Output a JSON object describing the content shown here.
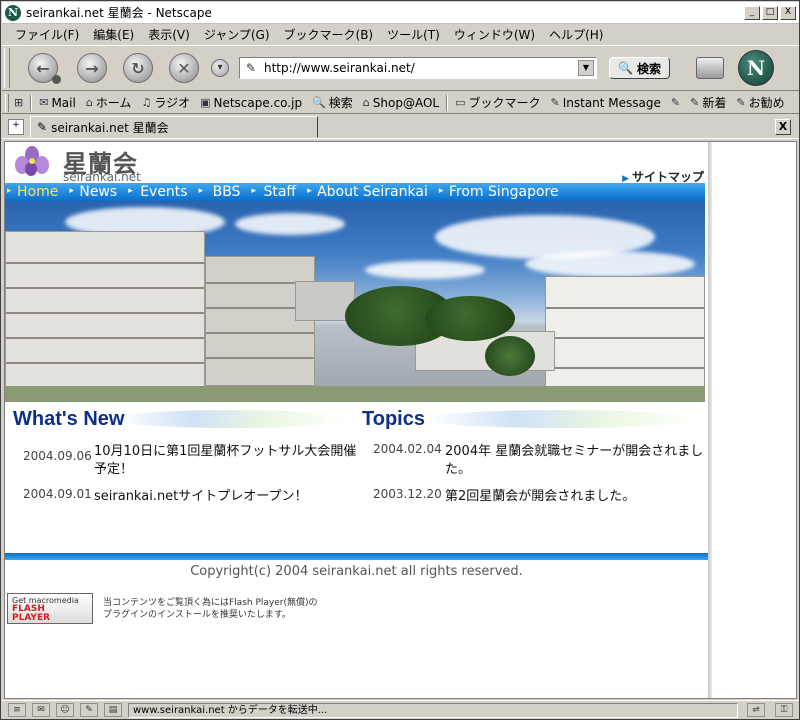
{
  "window": {
    "title": "seirankai.net  星蘭会 - Netscape",
    "app_icon": "netscape-n-icon",
    "minimize": "_",
    "maximize": "□",
    "close": "X"
  },
  "menu": [
    "ファイル(F)",
    "編集(E)",
    "表示(V)",
    "ジャンプ(G)",
    "ブックマーク(B)",
    "ツール(T)",
    "ウィンドウ(W)",
    "ヘルプ(H)"
  ],
  "nav": {
    "url": "http://www.seirankai.net/",
    "search_label": "検索",
    "logo_letter": "N"
  },
  "personal_toolbar": [
    {
      "label": "Mail",
      "icon": "mail-icon"
    },
    {
      "label": "ホーム",
      "icon": "home-icon"
    },
    {
      "label": "ラジオ",
      "icon": "headphones-icon"
    },
    {
      "label": "Netscape.co.jp",
      "icon": "my-icon"
    },
    {
      "label": "検索",
      "icon": "search-icon"
    },
    {
      "label": "Shop@AOL",
      "icon": "shop-icon"
    },
    {
      "label": "ブックマーク",
      "icon": "folder-icon"
    },
    {
      "label": "Instant Message",
      "icon": "link-icon"
    },
    {
      "label": "",
      "icon": "link-icon"
    },
    {
      "label": "新着",
      "icon": "link-icon"
    },
    {
      "label": "お勧め",
      "icon": "link-icon"
    }
  ],
  "tab": {
    "label": "seirankai.net  星蘭会",
    "close": "X"
  },
  "site": {
    "title": "星蘭会",
    "domain": "seirankai.net",
    "sitemap": "サイトマップ",
    "nav": [
      "Home",
      "News",
      "Events",
      "BBS",
      "Staff",
      "About Seirankai",
      "From Singapore"
    ],
    "active_nav": "Home"
  },
  "whats_new": {
    "heading": "What's New",
    "items": [
      {
        "date": "2004.09.06",
        "text_line1": "10月10日に第1回星蘭杯フットサル大会開催",
        "text_line2": "予定！"
      },
      {
        "date": "2004.09.01",
        "text_line1": "seirankai.netサイトプレオープン！",
        "text_line2": ""
      }
    ]
  },
  "topics": {
    "heading": "Topics",
    "items": [
      {
        "date": "2004.02.04",
        "text_line1": "2004年 星蘭会就職セミナーが開会されまし",
        "text_line2": "た。"
      },
      {
        "date": "2003.12.20",
        "text_line1": "第2回星蘭会が開会されました。",
        "text_line2": ""
      }
    ]
  },
  "footer": {
    "copyright": "Copyright(c) 2004 seirankai.net all rights reserved.",
    "flash_badge_line1": "Get macromedia",
    "flash_badge_line2": "FLASH",
    "flash_badge_line3": "PLAYER",
    "flash_note_line1": "当コンテンツをご覧頂く為にはFlash Player(無償)の",
    "flash_note_line2": "プラグインのインストールを推奨いたします。"
  },
  "status": {
    "text": "www.seirankai.net からデータを転送中..."
  }
}
